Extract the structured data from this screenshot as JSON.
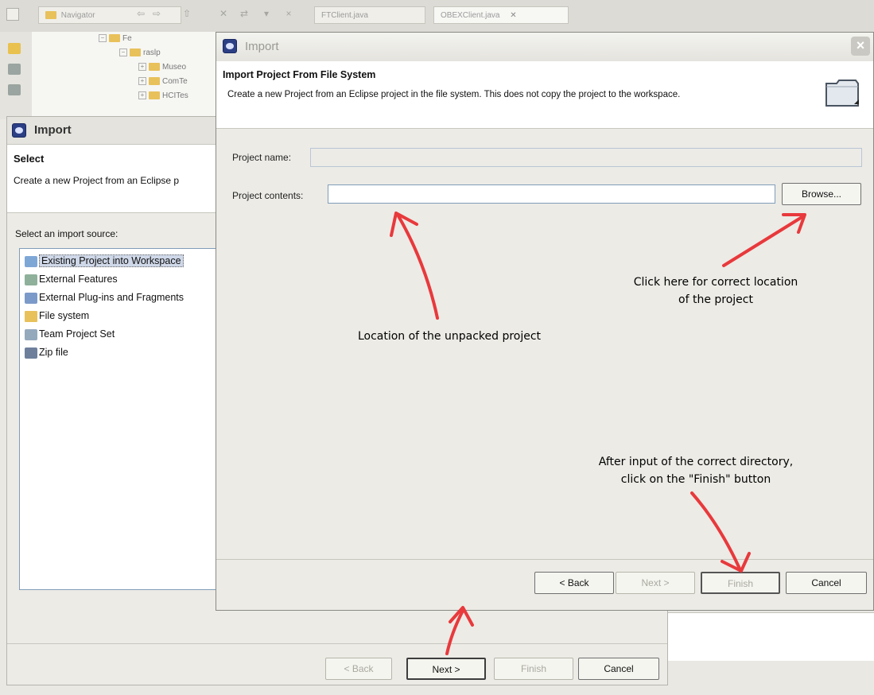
{
  "workbench": {
    "navigator_tab": "Navigator",
    "editor_tabs": [
      "FTClient.java",
      "OBEXClient.java"
    ],
    "tree_items": [
      "Fe",
      "raslp",
      "Museo",
      "ComTe",
      "HCITes"
    ]
  },
  "import_dialog_bg": {
    "title": "Import",
    "header_title": "Select",
    "header_desc": "Create a new Project from an Eclipse p",
    "source_label": "Select an import source:",
    "sources": [
      "Existing Project into Workspace",
      "External Features",
      "External Plug-ins and Fragments",
      "File system",
      "Team Project Set",
      "Zip file"
    ],
    "buttons": {
      "back": "< Back",
      "next": "Next >",
      "finish": "Finish",
      "cancel": "Cancel"
    }
  },
  "import_dialog_fg": {
    "title": "Import",
    "header_title": "Import Project From File System",
    "header_desc": "Create a new Project from an Eclipse project in the file system. This does not copy the project to the workspace.",
    "project_name_label": "Project name:",
    "project_name_value": "",
    "project_contents_label": "Project contents:",
    "project_contents_value": "",
    "browse_label": "Browse...",
    "buttons": {
      "back": "< Back",
      "next": "Next >",
      "finish": "Finish",
      "cancel": "Cancel"
    }
  },
  "annotations": {
    "browse_line1": "Click here for correct location",
    "browse_line2": "of the project",
    "location": "Location of the unpacked project",
    "finish_line1": "After input of the correct directory,",
    "finish_line2": "click on the \"Finish\" button"
  },
  "colors": {
    "arrow": "#e8393c",
    "selection": "#cfd8e8",
    "dialog": "#ecebe6"
  }
}
